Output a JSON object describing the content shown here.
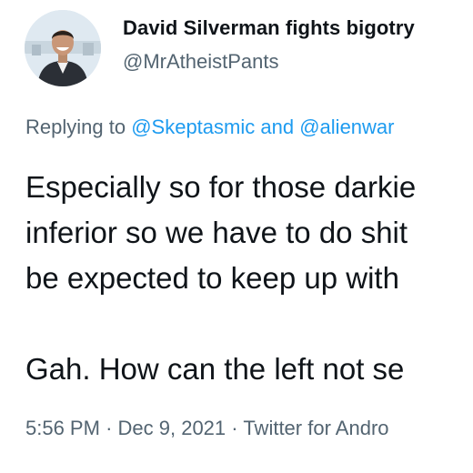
{
  "author": {
    "display_name": "David Silverman fights bigotry",
    "handle": "@MrAtheistPants",
    "avatar_icon": "profile-photo"
  },
  "reply": {
    "prefix": "Replying to",
    "mention_1": "@Skeptasmic",
    "connector": "and",
    "mention_2": "@alienwar"
  },
  "tweet": {
    "lines": [
      "Especially so for those darkie",
      "inferior so we have to do shit",
      "be expected to keep up with",
      "Gah.  How can the left not se"
    ]
  },
  "meta": {
    "time": "5:56 PM",
    "date": "Dec 9, 2021",
    "client": "Twitter for Andro"
  },
  "colors": {
    "mention": "#1d9bf0",
    "secondary_text": "#536471",
    "primary_text": "#0f1419"
  }
}
